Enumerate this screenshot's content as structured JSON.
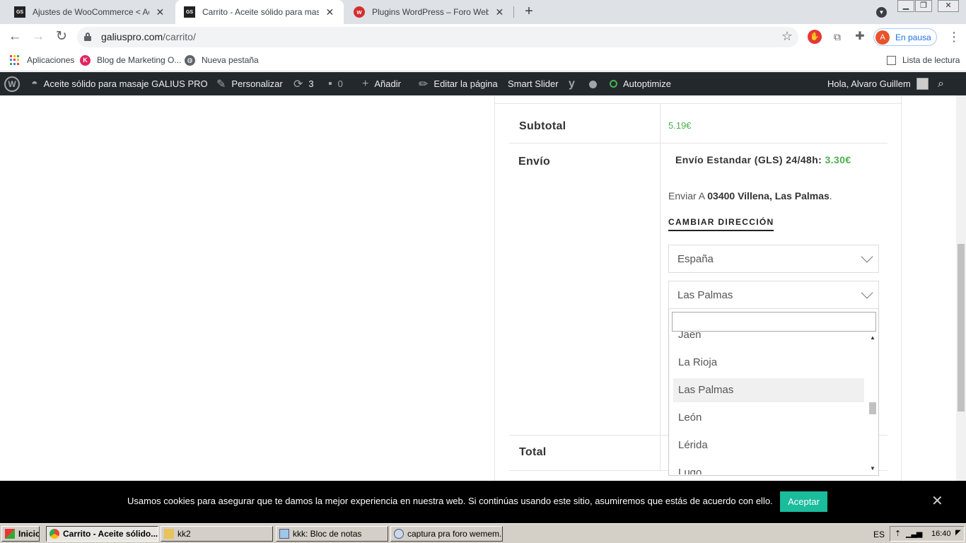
{
  "browser": {
    "tabs": [
      {
        "favicon": "GS",
        "title": "Ajustes de WooCommerce < Aceite",
        "active": false
      },
      {
        "favicon": "GS",
        "title": "Carrito - Aceite sólido para masaje G",
        "active": true
      },
      {
        "favicon": "w",
        "title": "Plugins WordPress – Foro Webempr",
        "active": false
      }
    ],
    "url_host": "galiuspro.com",
    "url_path": "/carrito/",
    "profile_initial": "A",
    "profile_label": "En pausa",
    "bookmarks": {
      "apps": "Aplicaciones",
      "blog": "Blog de Marketing O...",
      "new_tab": "Nueva pestaña",
      "reading_list": "Lista de lectura"
    }
  },
  "wp_admin_bar": {
    "site_name": "Aceite sólido para masaje GALIUS PRO",
    "customize": "Personalizar",
    "updates": "3",
    "comments": "0",
    "new": "Añadir",
    "edit_page": "Editar la página",
    "smart_slider": "Smart Slider",
    "autoptimize": "Autoptimize",
    "greeting": "Hola, Alvaro Guillem"
  },
  "cart": {
    "subtotal_label": "Subtotal",
    "subtotal_value": "5.19€",
    "shipping_label": "Envío",
    "shipping_method": "Envío Estandar (GLS) 24/48h:",
    "shipping_price": "3.30€",
    "ship_to_prefix": "Enviar A",
    "ship_to_address": "03400 Villena, Las Palmas",
    "ship_to_suffix": ".",
    "change_address": "CAMBIAR DIRECCIÓN",
    "country_selected": "España",
    "state_selected": "Las Palmas",
    "state_search_value": "",
    "state_options": [
      "Jaén",
      "La Rioja",
      "Las Palmas",
      "León",
      "Lérida",
      "Lugo"
    ],
    "highlighted_option": "Las Palmas",
    "total_label": "Total"
  },
  "cookie": {
    "message": "Usamos cookies para asegurar que te damos la mejor experiencia en nuestra web. Si continúas usando este sitio, asumiremos que estás de acuerdo con ello.",
    "accept": "Aceptar"
  },
  "taskbar": {
    "start": "Inicio",
    "items": [
      "Carrito - Aceite sólido...",
      "kk2",
      "kkk: Bloc de notas",
      "captura pra foro wemem..."
    ],
    "language": "ES",
    "clock": "16:40"
  },
  "colors": {
    "price_green": "#4caf50",
    "accept_button": "#1abc9c",
    "wp_bar": "#23282d"
  }
}
